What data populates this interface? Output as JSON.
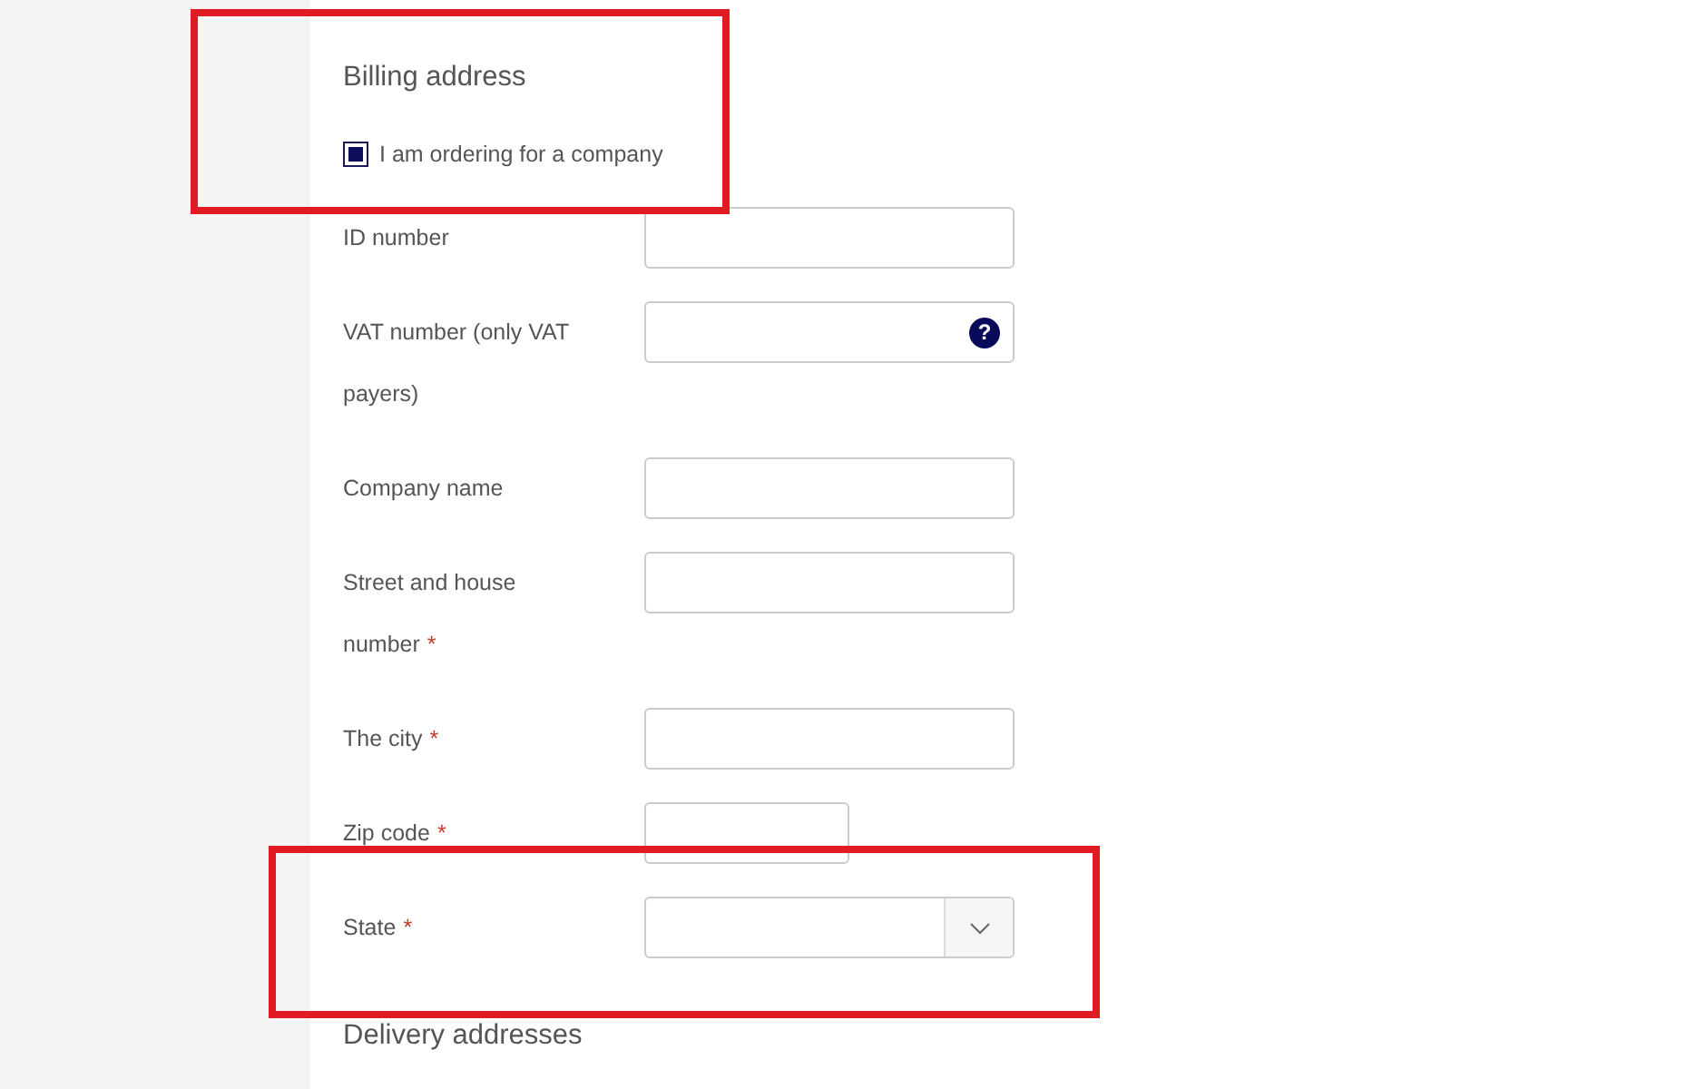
{
  "billing_heading": "Billing address",
  "company_checkbox": {
    "label": "I am ordering for a company",
    "checked": true
  },
  "fields": [
    {
      "label": "ID number",
      "required": false,
      "kind": "text"
    },
    {
      "label": "VAT number (only VAT payers)",
      "required": false,
      "kind": "help",
      "help_icon": "?"
    },
    {
      "label": "Company name",
      "required": false,
      "kind": "text"
    },
    {
      "label": "Street and house number",
      "required": true,
      "kind": "text"
    },
    {
      "label": "The city",
      "required": true,
      "kind": "text"
    },
    {
      "label": "Zip code",
      "required": true,
      "kind": "short"
    },
    {
      "label": "State",
      "required": true,
      "kind": "select"
    }
  ],
  "required_mark": "*",
  "delivery_heading": "Delivery addresses"
}
